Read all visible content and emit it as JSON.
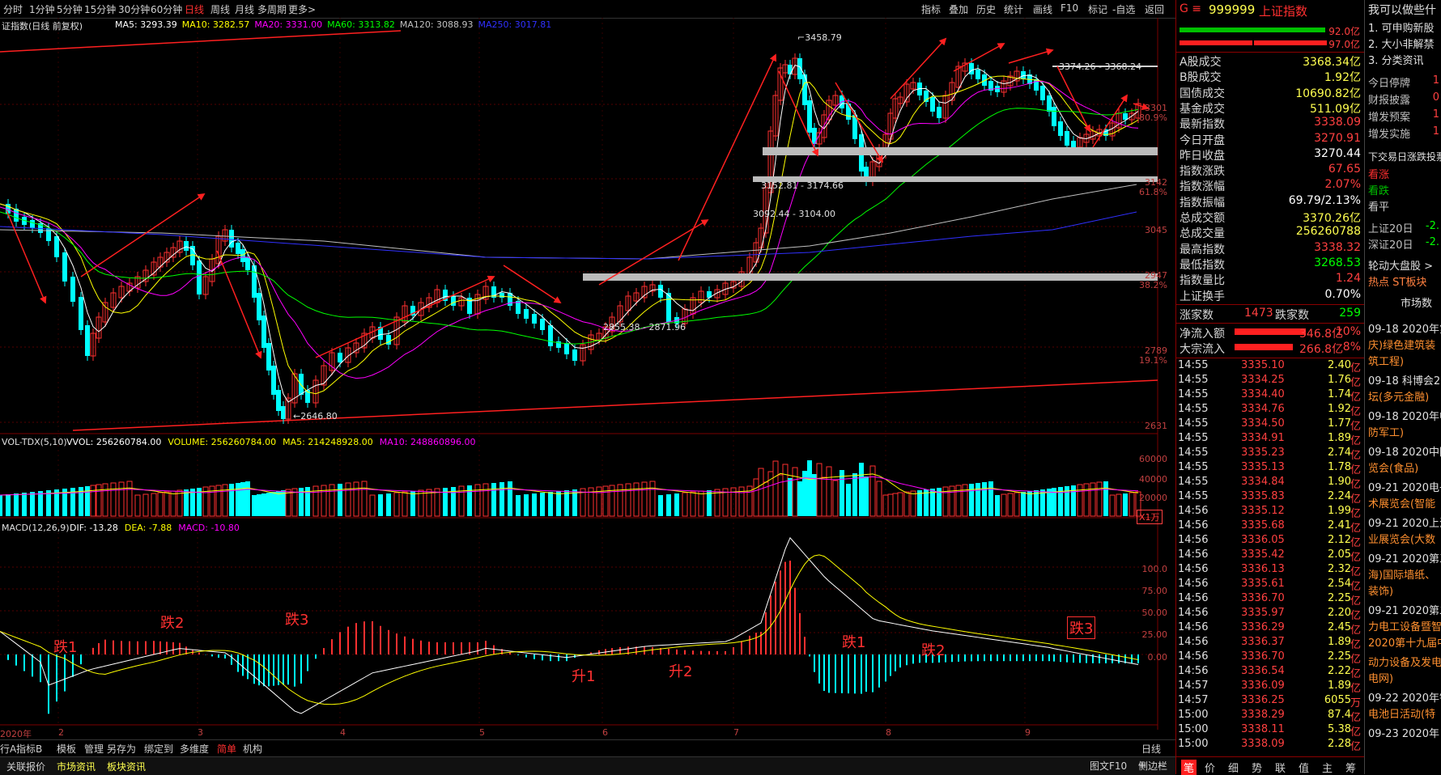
{
  "topbar": {
    "left_tabs": [
      {
        "label": "分时",
        "active": false
      },
      {
        "label": "1分钟",
        "active": false
      },
      {
        "label": "5分钟",
        "active": false
      },
      {
        "label": "15分钟",
        "active": false
      },
      {
        "label": "30分钟",
        "active": false
      },
      {
        "label": "60分钟",
        "active": false
      },
      {
        "label": "日线",
        "active": true
      },
      {
        "label": "周线",
        "active": false
      },
      {
        "label": "月线",
        "active": false
      },
      {
        "label": "多周期",
        "active": false
      },
      {
        "label": "更多>",
        "active": false
      }
    ],
    "right_tabs": [
      "指标",
      "叠加",
      "历史",
      "统计",
      "画线",
      "F10",
      "标记",
      "-自选",
      "返回"
    ]
  },
  "main_chart": {
    "title": "证指数(日线 前复权)",
    "ma_legend": [
      {
        "text": "MA5: 3293.39",
        "color": "#ffffff"
      },
      {
        "text": "MA10: 3282.57",
        "color": "#ffff00"
      },
      {
        "text": "MA20: 3331.00",
        "color": "#ff00ff"
      },
      {
        "text": "MA60: 3313.82",
        "color": "#00ff00"
      },
      {
        "text": "MA120: 3088.93",
        "color": "#c0c0c0"
      },
      {
        "text": "MA250: 3017.81",
        "color": "#3030ff"
      }
    ],
    "y_labels": [
      {
        "text": "3301",
        "pct": "80.9%"
      },
      {
        "text": "3142",
        "pct": "61.8%"
      },
      {
        "text": "3045",
        "pct": ""
      },
      {
        "text": "2947",
        "pct": "38.2%"
      },
      {
        "text": "2789",
        "pct": "19.1%"
      },
      {
        "text": "2631",
        "pct": ""
      }
    ],
    "annotations": {
      "high": "3458.79",
      "low": "2646.80",
      "zone1": "3374.26 - 3368.24",
      "zone2": "3152.81 - 3174.66",
      "zone3": "3092.44 - 3104.00",
      "zone4": "2855.38 - 2871.96"
    },
    "x_labels": [
      "2020年",
      "2",
      "3",
      "4",
      "5",
      "6",
      "7",
      "8",
      "9"
    ]
  },
  "volume": {
    "title": "VOL-TDX(5,10)",
    "legend": [
      {
        "text": "VVOL: 256260784.00",
        "color": "#ffffff"
      },
      {
        "text": "VOLUME: 256260784.00",
        "color": "#ffff00"
      },
      {
        "text": "MA5: 214248928.00",
        "color": "#ffff00"
      },
      {
        "text": "MA10: 248860896.00",
        "color": "#ff00ff"
      }
    ],
    "y_labels": [
      "60000",
      "40000",
      "20000"
    ],
    "unit": "X1万"
  },
  "macd": {
    "title": "MACD(12,26,9)",
    "legend": [
      {
        "text": "DIF: -13.28",
        "color": "#ffffff"
      },
      {
        "text": "DEA: -7.88",
        "color": "#ffff00"
      },
      {
        "text": "MACD: -10.80",
        "color": "#ff00ff"
      }
    ],
    "y_labels": [
      "100.0",
      "75.00",
      "50.00",
      "25.00",
      "0.00"
    ],
    "marks": [
      "跌1",
      "跌2",
      "跌3",
      "升1",
      "升2",
      "跌1",
      "跌2",
      "跌3"
    ]
  },
  "midbar": {
    "items": [
      "行A",
      "指标B",
      "模板",
      "管理",
      "另存为",
      "绑定到",
      "多维度",
      "简单",
      "机构"
    ],
    "day_label": "日线",
    "plus": "+",
    "minus": "−"
  },
  "bottombar": {
    "items": [
      "关联报价",
      "市场资讯",
      "板块资讯"
    ],
    "right_items": [
      "图文F10",
      "侧边栏"
    ]
  },
  "quote_panel": {
    "code": "999999",
    "name": "上证指数",
    "bar1": "92.0亿",
    "bar2": "97.0亿",
    "rows": [
      {
        "label": "A股成交",
        "value": "3368.34亿",
        "color": "#ffff50"
      },
      {
        "label": "B股成交",
        "value": "1.92亿",
        "color": "#ffff50"
      },
      {
        "label": "国债成交",
        "value": "10690.82亿",
        "color": "#ffff50"
      },
      {
        "label": "基金成交",
        "value": "511.09亿",
        "color": "#ffff50"
      },
      {
        "label": "最新指数",
        "value": "3338.09",
        "color": "#ff4040"
      },
      {
        "label": "今日开盘",
        "value": "3270.91",
        "color": "#ff4040"
      },
      {
        "label": "昨日收盘",
        "value": "3270.44",
        "color": "#ffffff"
      },
      {
        "label": "指数涨跌",
        "value": "67.65",
        "color": "#ff4040"
      },
      {
        "label": "指数涨幅",
        "value": "2.07%",
        "color": "#ff4040"
      },
      {
        "label": "指数振幅",
        "value": "69.79/2.13%",
        "color": "#ffffff"
      },
      {
        "label": "总成交额",
        "value": "3370.26亿",
        "color": "#ffff50"
      },
      {
        "label": "总成交量",
        "value": "256260788",
        "color": "#ffff50"
      },
      {
        "label": "最高指数",
        "value": "3338.32",
        "color": "#ff4040"
      },
      {
        "label": "最低指数",
        "value": "3268.53",
        "color": "#00ff00"
      },
      {
        "label": "指数量比",
        "value": "1.24",
        "color": "#ff4040"
      },
      {
        "label": "上证换手",
        "value": "0.70%",
        "color": "#ffffff"
      }
    ],
    "up_label": "涨家数",
    "up_value": "1473",
    "down_label": "跌家数",
    "down_value": "259",
    "inflow_label": "净流入额",
    "inflow_value": "346.8亿",
    "inflow_pct": "10%",
    "block_label": "大宗流入",
    "block_value": "266.8亿",
    "block_pct": "8%",
    "ticks": [
      {
        "t": "14:55",
        "p": "3335.10",
        "v": "2.40",
        "u": "亿"
      },
      {
        "t": "14:55",
        "p": "3334.25",
        "v": "1.76",
        "u": "亿"
      },
      {
        "t": "14:55",
        "p": "3334.40",
        "v": "1.74",
        "u": "亿"
      },
      {
        "t": "14:55",
        "p": "3334.76",
        "v": "1.92",
        "u": "亿"
      },
      {
        "t": "14:55",
        "p": "3334.50",
        "v": "1.77",
        "u": "亿"
      },
      {
        "t": "14:55",
        "p": "3334.91",
        "v": "1.89",
        "u": "亿"
      },
      {
        "t": "14:55",
        "p": "3335.23",
        "v": "2.74",
        "u": "亿"
      },
      {
        "t": "14:55",
        "p": "3335.13",
        "v": "1.78",
        "u": "亿"
      },
      {
        "t": "14:55",
        "p": "3334.84",
        "v": "1.90",
        "u": "亿"
      },
      {
        "t": "14:55",
        "p": "3335.83",
        "v": "2.24",
        "u": "亿"
      },
      {
        "t": "14:56",
        "p": "3335.12",
        "v": "1.99",
        "u": "亿"
      },
      {
        "t": "14:56",
        "p": "3335.68",
        "v": "2.41",
        "u": "亿"
      },
      {
        "t": "14:56",
        "p": "3336.05",
        "v": "2.12",
        "u": "亿"
      },
      {
        "t": "14:56",
        "p": "3335.42",
        "v": "2.05",
        "u": "亿"
      },
      {
        "t": "14:56",
        "p": "3336.13",
        "v": "2.32",
        "u": "亿"
      },
      {
        "t": "14:56",
        "p": "3335.61",
        "v": "2.54",
        "u": "亿"
      },
      {
        "t": "14:56",
        "p": "3336.70",
        "v": "2.25",
        "u": "亿"
      },
      {
        "t": "14:56",
        "p": "3335.97",
        "v": "2.20",
        "u": "亿"
      },
      {
        "t": "14:56",
        "p": "3336.29",
        "v": "2.45",
        "u": "亿"
      },
      {
        "t": "14:56",
        "p": "3336.37",
        "v": "1.89",
        "u": "亿"
      },
      {
        "t": "14:56",
        "p": "3336.70",
        "v": "2.25",
        "u": "亿"
      },
      {
        "t": "14:56",
        "p": "3336.54",
        "v": "2.22",
        "u": "亿"
      },
      {
        "t": "14:57",
        "p": "3336.09",
        "v": "1.89",
        "u": "亿"
      },
      {
        "t": "14:57",
        "p": "3336.25",
        "v": "6055",
        "u": "万"
      },
      {
        "t": "15:00",
        "p": "3338.29",
        "v": "87.4",
        "u": "亿"
      },
      {
        "t": "15:00",
        "p": "3338.11",
        "v": "5.38",
        "u": "亿"
      },
      {
        "t": "15:00",
        "p": "3338.09",
        "v": "2.28",
        "u": "亿"
      }
    ],
    "bottom_tabs": [
      "笔",
      "价",
      "细",
      "势",
      "联",
      "值",
      "主",
      "筹"
    ]
  },
  "far_right": {
    "header": "我可以做些什",
    "menu": [
      "1. 可申购新股",
      "2. 大小非解禁",
      "3. 分类资讯"
    ],
    "stats": [
      {
        "label": "今日停牌",
        "value": "1"
      },
      {
        "label": "财报披露",
        "value": "0"
      },
      {
        "label": "增发预案",
        "value": "1"
      },
      {
        "label": "增发实施",
        "value": "1"
      }
    ],
    "poll_title": "下交易日涨跌投票",
    "poll": [
      {
        "label": "看涨",
        "color": "#ff3030"
      },
      {
        "label": "看跌",
        "color": "#00c000"
      },
      {
        "label": "看平",
        "color": "#d0d0d0"
      }
    ],
    "idx": [
      {
        "label": "上证20日",
        "value": "-2."
      },
      {
        "label": "深证20日",
        "value": "-2."
      }
    ],
    "rotation": "轮动大盘股 >",
    "hot": "热点 ST板块",
    "market": "市场数",
    "news": [
      {
        "date": "09-18 2020年第",
        "line2": "庆)绿色建筑装",
        "line3": "筑工程)"
      },
      {
        "date": "09-18 科博会2",
        "line2": "坛(多元金融)",
        "line3": ""
      },
      {
        "date": "09-18 2020年中",
        "line2": "防军工)",
        "line3": ""
      },
      {
        "date": "09-18 2020中国",
        "line2": "览会(食品)",
        "line3": ""
      },
      {
        "date": "09-21 2020电子",
        "line2": "术展览会(智能",
        "line3": ""
      },
      {
        "date": "09-21 2020上海",
        "line2": "业展览会(大数",
        "line3": ""
      },
      {
        "date": "09-21 2020第三",
        "line2": "海)国际墙纸、",
        "line3": "装饰)"
      },
      {
        "date": "09-21 2020第二",
        "line2": "力电工设备暨智",
        "line3": "2020第十九届中"
      },
      {
        "date": "",
        "line2": "动力设备及发电",
        "line3": "电网)"
      },
      {
        "date": "09-22 2020年钜",
        "line2": "电池日活动(特",
        "line3": ""
      },
      {
        "date": "09-23 2020年",
        "line2": "",
        "line3": ""
      }
    ]
  },
  "colors": {
    "up": "#ff3030",
    "down": "#00ffff",
    "ma5": "#ffffff",
    "ma10": "#ffff00",
    "ma20": "#ff00ff",
    "ma60": "#00ff00",
    "ma120": "#c0c0c0",
    "ma250": "#3030ff"
  }
}
